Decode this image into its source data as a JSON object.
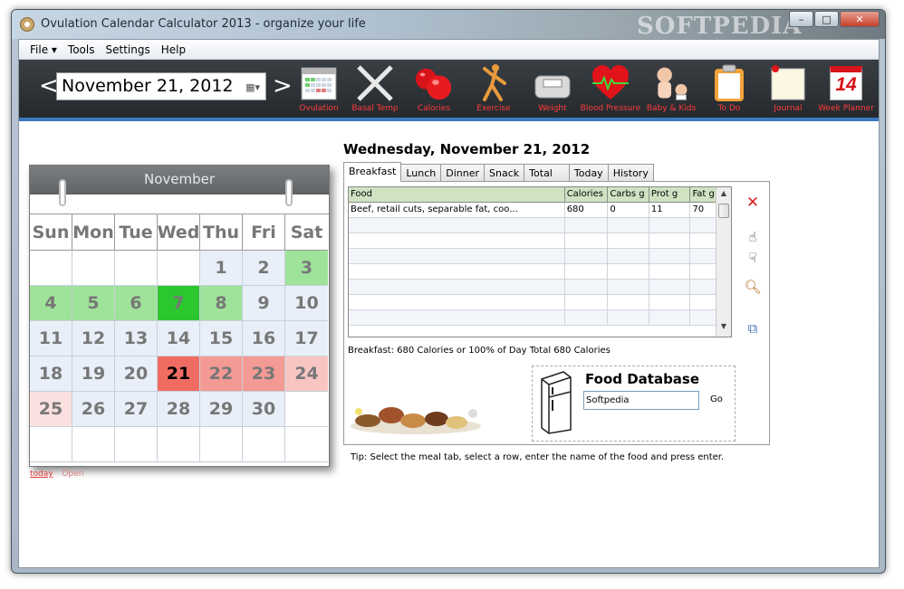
{
  "window": {
    "title": "Ovulation Calendar Calculator 2013 - organize your life",
    "watermark": "SOFTPEDIA",
    "min": "–",
    "max": "□",
    "close": "✕"
  },
  "menu": [
    "File ▾",
    "Tools",
    "Settings",
    "Help"
  ],
  "toolbar": {
    "prev": "<",
    "next": ">",
    "date": "November  21, 2012",
    "date_drop": "▦▾",
    "tools": [
      {
        "label": "Ovulation",
        "icon": "calendar-icon"
      },
      {
        "label": "Basal Temp",
        "icon": "thermometer-icon"
      },
      {
        "label": "Calories",
        "icon": "apple-icon"
      },
      {
        "label": "Exercise",
        "icon": "exercise-icon"
      },
      {
        "label": "Weight",
        "icon": "scale-icon"
      },
      {
        "label": "Blood Pressure",
        "icon": "heart-icon"
      },
      {
        "label": "Baby & Kids",
        "icon": "baby-icon"
      },
      {
        "label": "To Do",
        "icon": "clipboard-icon"
      },
      {
        "label": "Journal",
        "icon": "journal-icon"
      },
      {
        "label": "Week Planner",
        "icon": "week-planner-icon"
      }
    ],
    "week_planner_num": "14"
  },
  "calendar": {
    "month": "November",
    "days_of_week": [
      "Sun",
      "Mon",
      "Tue",
      "Wed",
      "Thu",
      "Fri",
      "Sat"
    ],
    "cells": [
      {
        "d": "",
        "c": "white"
      },
      {
        "d": "",
        "c": "white"
      },
      {
        "d": "",
        "c": "white"
      },
      {
        "d": "",
        "c": "white"
      },
      {
        "d": "1",
        "c": "blue"
      },
      {
        "d": "2",
        "c": "blue"
      },
      {
        "d": "3",
        "c": "green"
      },
      {
        "d": "4",
        "c": "green"
      },
      {
        "d": "5",
        "c": "green"
      },
      {
        "d": "6",
        "c": "green"
      },
      {
        "d": "7",
        "c": "dgreen"
      },
      {
        "d": "8",
        "c": "green"
      },
      {
        "d": "9",
        "c": "blue"
      },
      {
        "d": "10",
        "c": "blue"
      },
      {
        "d": "11",
        "c": "blue"
      },
      {
        "d": "12",
        "c": "blue"
      },
      {
        "d": "13",
        "c": "blue"
      },
      {
        "d": "14",
        "c": "blue"
      },
      {
        "d": "15",
        "c": "blue"
      },
      {
        "d": "16",
        "c": "blue"
      },
      {
        "d": "17",
        "c": "blue"
      },
      {
        "d": "18",
        "c": "blue"
      },
      {
        "d": "19",
        "c": "blue"
      },
      {
        "d": "20",
        "c": "blue"
      },
      {
        "d": "21",
        "c": "red"
      },
      {
        "d": "22",
        "c": "pink"
      },
      {
        "d": "23",
        "c": "pink"
      },
      {
        "d": "24",
        "c": "lpink"
      },
      {
        "d": "25",
        "c": "vlpink"
      },
      {
        "d": "26",
        "c": "blue"
      },
      {
        "d": "27",
        "c": "blue"
      },
      {
        "d": "28",
        "c": "blue"
      },
      {
        "d": "29",
        "c": "blue"
      },
      {
        "d": "30",
        "c": "blue"
      },
      {
        "d": "",
        "c": "white"
      },
      {
        "d": "",
        "c": "white"
      },
      {
        "d": "",
        "c": "white"
      },
      {
        "d": "",
        "c": "white"
      },
      {
        "d": "",
        "c": "white"
      },
      {
        "d": "",
        "c": "white"
      },
      {
        "d": "",
        "c": "white"
      },
      {
        "d": "",
        "c": "white"
      }
    ],
    "link_today": "today",
    "link_open": "Open"
  },
  "day_title": "Wednesday, November 21, 2012",
  "tabs": [
    "Breakfast",
    "Lunch",
    "Dinner",
    "Snack",
    "Total",
    "Today",
    "History"
  ],
  "active_tab": "Breakfast",
  "grid": {
    "columns": [
      "Food",
      "Calories",
      "Carbs g",
      "Prot g",
      "Fat g"
    ],
    "rows": [
      [
        "Beef, retail cuts, separable fat, coo...",
        "680",
        "0",
        "11",
        "70"
      ],
      [
        "",
        "",
        "",
        "",
        ""
      ],
      [
        "",
        "",
        "",
        "",
        ""
      ],
      [
        "",
        "",
        "",
        "",
        ""
      ],
      [
        "",
        "",
        "",
        "",
        ""
      ],
      [
        "",
        "",
        "",
        "",
        ""
      ],
      [
        "",
        "",
        "",
        "",
        ""
      ],
      [
        "",
        "",
        "",
        "",
        ""
      ]
    ]
  },
  "side_icons": [
    "delete-icon",
    "thumbs-up-icon",
    "thumbs-down-icon",
    "search-icon",
    "copy-icon"
  ],
  "summary": "Breakfast: 680 Calories or 100% of Day Total 680 Calories",
  "food_db": {
    "title": "Food Database",
    "input_value": "Softpedia",
    "go": "Go"
  },
  "tip": "Tip: Select the meal tab, select a row, enter the name of the food and press enter."
}
